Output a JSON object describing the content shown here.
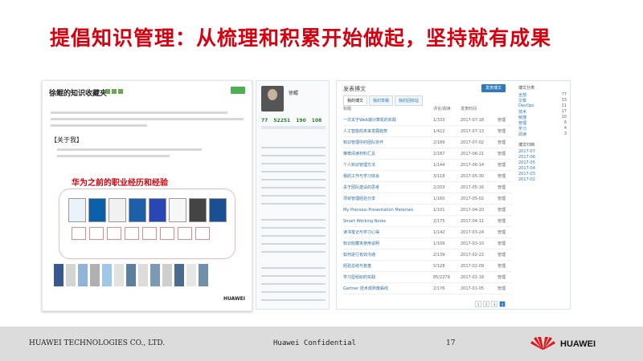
{
  "slide": {
    "title": "提倡知识管理：从梳理和积累开始做起，坚持就有成果"
  },
  "blog": {
    "title": "徐鲲的知识收藏夹",
    "about": "【关于我】",
    "career_title": "华为之前的职业经历和经验",
    "footer_brand": "HUAWEI"
  },
  "profile": {
    "name": "徐鲲",
    "stats": [
      "77",
      "52251",
      "190",
      "108"
    ]
  },
  "list": {
    "new_button": "发表博文",
    "tabs": [
      "我的博文",
      "我的草稿",
      "我的回收站"
    ],
    "columns": [
      "标题",
      "评论/阅读",
      "发表时间"
    ],
    "rows": [
      {
        "title": "一次关于Web端计算机的实践",
        "meta": "1/333",
        "date": "2017-07-18",
        "action": "管理"
      },
      {
        "title": "人工智能的未来发展趋势",
        "meta": "1/422",
        "date": "2017-07-13",
        "action": "管理"
      },
      {
        "title": "知识管理中的团队协作",
        "meta": "2/189",
        "date": "2017-07-02",
        "action": "管理"
      },
      {
        "title": "推荐阅读材料汇总",
        "meta": "2/187",
        "date": "2017-06-21",
        "action": "管理"
      },
      {
        "title": "个人知识管理方法",
        "meta": "1/144",
        "date": "2017-06-14",
        "action": "管理"
      },
      {
        "title": "我的工作与学习体会",
        "meta": "3/118",
        "date": "2017-05-30",
        "action": "管理"
      },
      {
        "title": "关于团队建设的思考",
        "meta": "2/203",
        "date": "2017-05-16",
        "action": "管理"
      },
      {
        "title": "项目管理经验分享",
        "meta": "1/160",
        "date": "2017-05-02",
        "action": "管理"
      },
      {
        "title": "My Precious Presentation Materials",
        "meta": "1/101",
        "date": "2017-04-20",
        "action": "管理"
      },
      {
        "title": "Smart Working Notes",
        "meta": "2/175",
        "date": "2017-04-11",
        "action": "管理"
      },
      {
        "title": "读书笔记与学习心得",
        "meta": "1/142",
        "date": "2017-03-24",
        "action": "管理"
      },
      {
        "title": "知识收藏夹使用说明",
        "meta": "1/109",
        "date": "2017-03-10",
        "action": "管理"
      },
      {
        "title": "如何进行有效沟通",
        "meta": "2/139",
        "date": "2017-02-22",
        "action": "管理"
      },
      {
        "title": "经验总结与复盘",
        "meta": "5/128",
        "date": "2017-02-09",
        "action": "管理"
      },
      {
        "title": "学习型组织的实践",
        "meta": "85/2279",
        "date": "2017-01-18",
        "action": "管理"
      },
      {
        "title": "Gartner 技术成熟度曲线",
        "meta": "2/176",
        "date": "2017-01-05",
        "action": "管理"
      }
    ],
    "pagination": [
      "1",
      "2",
      "3",
      "4"
    ],
    "current_page": "4"
  },
  "sidebar": {
    "category_title": "博文分类",
    "categories": [
      {
        "label": "全部",
        "count": "77"
      },
      {
        "label": "文章",
        "count": "33"
      },
      {
        "label": "DevOps",
        "count": "11"
      },
      {
        "label": "技术",
        "count": "17"
      },
      {
        "label": "敏捷",
        "count": "10"
      },
      {
        "label": "管理",
        "count": "6"
      },
      {
        "label": "学习",
        "count": "4"
      },
      {
        "label": "阅读",
        "count": "3"
      }
    ],
    "archive_title": "博文归档",
    "archives": [
      "2017-07",
      "2017-06",
      "2017-05",
      "2017-04",
      "2017-03",
      "2017-02"
    ]
  },
  "footer": {
    "company": "HUAWEI TECHNOLOGIES CO., LTD.",
    "confidential": "Huawei Confidential",
    "page_number": "17",
    "logo_text": "HUAWEI"
  },
  "colors": {
    "title_red": "#d7000f",
    "footer_gray": "#dcdcdc",
    "link_blue": "#2e79b9"
  }
}
